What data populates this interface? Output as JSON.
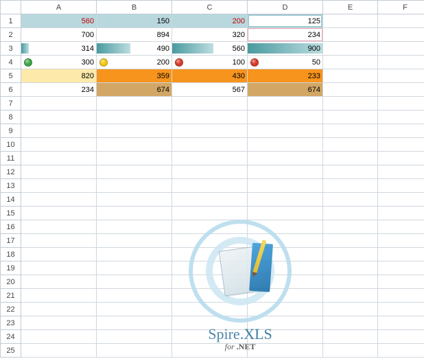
{
  "columns": [
    "A",
    "B",
    "C",
    "D",
    "E",
    "F"
  ],
  "row_count_visible": 25,
  "cells": {
    "r1": {
      "A": "560",
      "B": "150",
      "C": "200",
      "D": "125"
    },
    "r2": {
      "A": "700",
      "B": "894",
      "C": "320",
      "D": "234"
    },
    "r3": {
      "A": "314",
      "B": "490",
      "C": "560",
      "D": "900"
    },
    "r4": {
      "A": "300",
      "B": "200",
      "C": "100",
      "D": "50"
    },
    "r5": {
      "A": "820",
      "B": "359",
      "C": "430",
      "D": "233"
    },
    "r6": {
      "A": "234",
      "B": "674",
      "C": "567",
      "D": "674"
    }
  },
  "formatting": {
    "row1": {
      "A": "fill-lightblue text-red",
      "B": "fill-lightblue",
      "C": "fill-lightblue text-red",
      "D": "highlight-box"
    },
    "row2": {
      "D": "highlight-box-pink"
    },
    "row3_databars": {
      "A": 0.1,
      "B": 0.45,
      "C": 0.55,
      "D": 1.0
    },
    "row4_icons": {
      "A": "green",
      "B": "yellow",
      "C": "red",
      "D": "red"
    },
    "row5": {
      "A": "fill-lightyellow",
      "B": "fill-orange",
      "C": "fill-orange",
      "D": "fill-orange"
    },
    "row6": {
      "B": "fill-tan",
      "D": "fill-tan"
    }
  },
  "watermark": {
    "brand_prefix": "Spire",
    "brand_suffix": ".XLS",
    "subline_prefix": "for",
    "subline_suffix": ".NET"
  }
}
